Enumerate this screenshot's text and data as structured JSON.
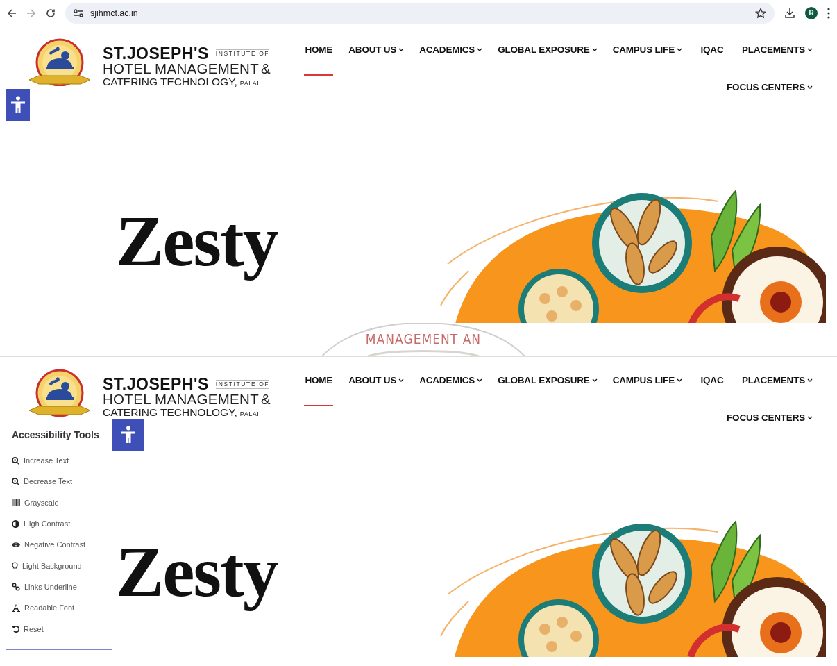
{
  "browser": {
    "url": "sjihmct.ac.in",
    "profile_initial": "R"
  },
  "views": [
    {
      "logo": {
        "name": "ST.JOSEPH'S",
        "tag": "INSTITUTE OF",
        "line2": "HOTEL MANAGEMENT",
        "amp": "&",
        "line3": "CATERING TECHNOLOGY,",
        "place": "PALAI"
      },
      "nav": [
        {
          "label": "HOME",
          "dropdown": false,
          "selected": true
        },
        {
          "label": "ABOUT US",
          "dropdown": true,
          "selected": false
        },
        {
          "label": "ACADEMICS",
          "dropdown": true,
          "selected": false
        },
        {
          "label": "GLOBAL EXPOSURE",
          "dropdown": true,
          "selected": false
        },
        {
          "label": "CAMPUS LIFE",
          "dropdown": true,
          "selected": false
        },
        {
          "label": "IQAC",
          "dropdown": false,
          "selected": false
        },
        {
          "label": "PLACEMENTS",
          "dropdown": true,
          "selected": false
        },
        {
          "label": "FOCUS CENTERS",
          "dropdown": true,
          "selected": false
        }
      ],
      "hero_lines": [
        "Zesty"
      ],
      "accessibility": {
        "open": false
      }
    },
    {
      "logo": {
        "name": "ST.JOSEPH'S",
        "tag": "INSTITUTE OF",
        "line2": "HOTEL MANAGEMENT",
        "amp": "&",
        "line3": "CATERING TECHNOLOGY,",
        "place": "PALAI"
      },
      "nav": [
        {
          "label": "HOME",
          "dropdown": false,
          "selected": true
        },
        {
          "label": "ABOUT US",
          "dropdown": true,
          "selected": false
        },
        {
          "label": "ACADEMICS",
          "dropdown": true,
          "selected": false
        },
        {
          "label": "GLOBAL EXPOSURE",
          "dropdown": true,
          "selected": false
        },
        {
          "label": "CAMPUS LIFE",
          "dropdown": true,
          "selected": false
        },
        {
          "label": "IQAC",
          "dropdown": false,
          "selected": false
        },
        {
          "label": "PLACEMENTS",
          "dropdown": true,
          "selected": false
        },
        {
          "label": "FOCUS CENTERS",
          "dropdown": true,
          "selected": false
        }
      ],
      "hero_lines": [
        "Zesty"
      ],
      "accessibility": {
        "open": true,
        "title": "Accessibility Tools",
        "items": [
          "Increase Text",
          "Decrease Text",
          "Grayscale",
          "High Contrast",
          "Negative Contrast",
          "Light Background",
          "Links Underline",
          "Readable Font",
          "Reset"
        ]
      }
    }
  ],
  "seal_text": "MANAGEMENT AN"
}
